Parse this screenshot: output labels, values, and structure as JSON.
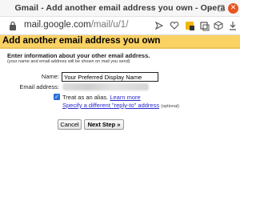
{
  "window": {
    "title": "Gmail - Add another email address you own - Opera",
    "min_glyph": "–",
    "max_glyph": "□",
    "close_glyph": "✕"
  },
  "toolbar": {
    "url_host": "mail.google.com",
    "url_path": "/mail/u/1/"
  },
  "dialog": {
    "heading": "Add another email address you own",
    "intro": "Enter information about your other email address.",
    "intro_sub": "(your name and email address will be shown on mail you send)",
    "name_label": "Name:",
    "name_value": "Your Preferred Display Name",
    "email_label": "Email address:",
    "alias_checked": true,
    "alias_text": "Treat as an alias.",
    "learn_more": "Learn more",
    "reply_to_link": "Specify a different \"reply-to\" address",
    "optional": "(optional)",
    "cancel_label": "Cancel",
    "next_label": "Next Step »"
  },
  "colors": {
    "header_bg": "#fad163",
    "link": "#2a2ad0",
    "checkbox": "#2a6fd6",
    "close_button": "#e95420"
  }
}
